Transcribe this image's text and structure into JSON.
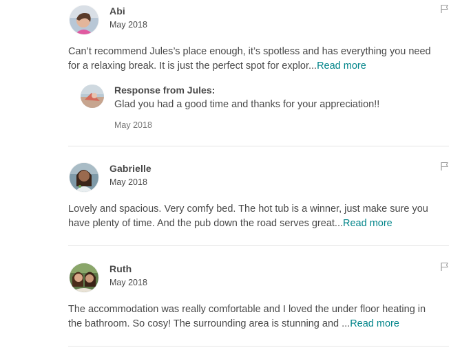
{
  "reviews": [
    {
      "name": "Abi",
      "date": "May 2018",
      "text_line1": "Can’t recommend Jules’s place enough, it’s spotless and has everything you need",
      "text_line2": "for a relaxing break. It is just the perfect spot for explor...",
      "read_more": "Read more",
      "response": {
        "title": "Response from Jules:",
        "text": "Glad you had a good time and thanks for your appreciation!!",
        "date": "May 2018"
      }
    },
    {
      "name": "Gabrielle",
      "date": "May 2018",
      "text_line1": "Lovely and spacious. Very comfy bed. The hot tub is a winner, just make sure you",
      "text_line2": "have plenty of time. And the pub down the road serves great...",
      "read_more": "Read more"
    },
    {
      "name": "Ruth",
      "date": "May 2018",
      "text_line1": "The accommodation was really comfortable and I loved the under floor heating in",
      "text_line2": "the bathroom. So cosy! The surrounding area is stunning and ...",
      "read_more": "Read more"
    }
  ],
  "colors": {
    "link": "#008489",
    "text": "#484848",
    "muted": "#767676",
    "divider": "#e4e4e4"
  },
  "icons": {
    "report": "flag-icon"
  }
}
